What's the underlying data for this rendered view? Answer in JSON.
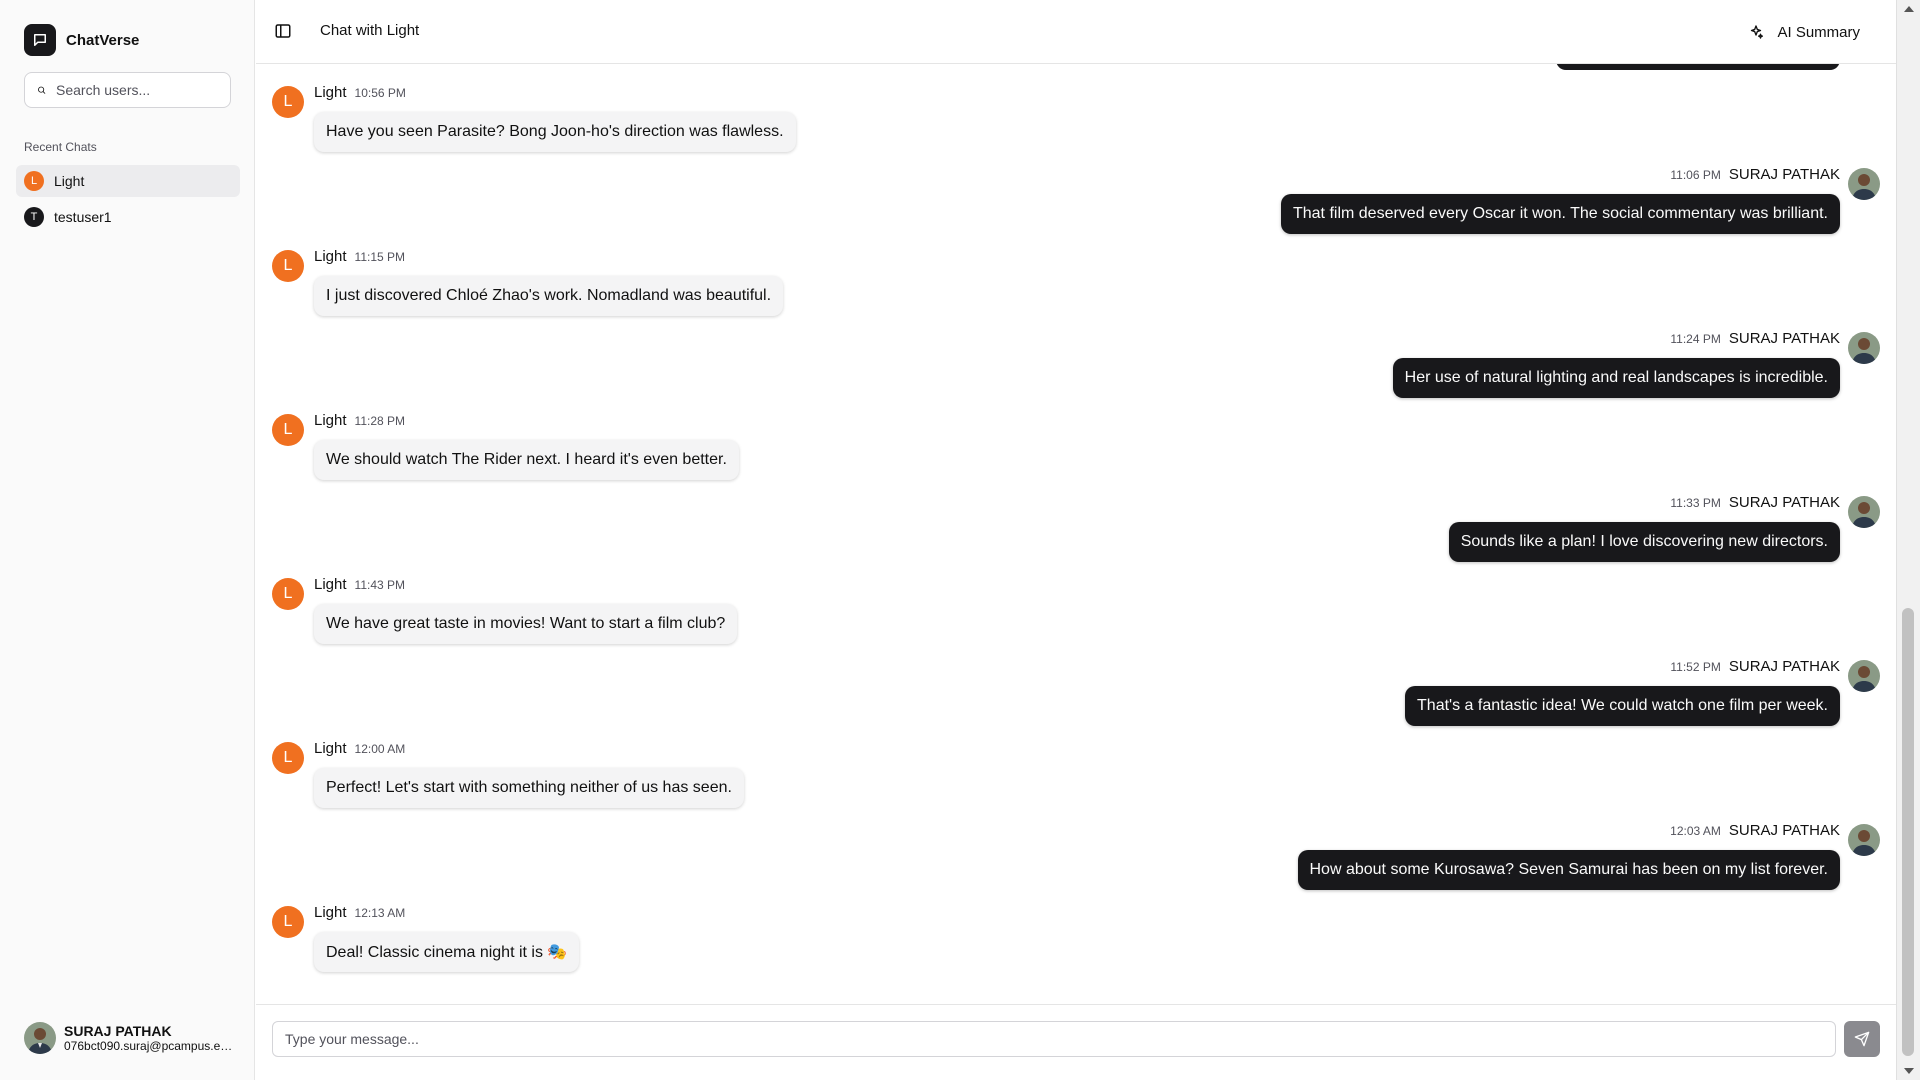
{
  "app": {
    "name": "ChatVerse"
  },
  "sidebar": {
    "search_placeholder": "Search users...",
    "section_label": "Recent Chats",
    "chats": [
      {
        "label": "Light",
        "initial": "L",
        "color": "#f07020",
        "active": true
      },
      {
        "label": "testuser1",
        "initial": "T",
        "color": "#18181b",
        "active": false
      }
    ],
    "profile": {
      "name": "SURAJ PATHAK",
      "email": "076bct090.suraj@pcampus.edu.np"
    }
  },
  "header": {
    "title": "Chat with Light",
    "ai_summary_label": "AI Summary"
  },
  "messages": [
    {
      "from": "Light",
      "initial": "L",
      "time": "10:56 PM",
      "text": "Have you seen Parasite? Bong Joon-ho's direction was flawless.",
      "outgoing": false
    },
    {
      "from": "SURAJ PATHAK",
      "time": "11:06 PM",
      "text": "That film deserved every Oscar it won. The social commentary was brilliant.",
      "outgoing": true
    },
    {
      "from": "Light",
      "initial": "L",
      "time": "11:15 PM",
      "text": "I just discovered Chloé Zhao's work. Nomadland was beautiful.",
      "outgoing": false
    },
    {
      "from": "SURAJ PATHAK",
      "time": "11:24 PM",
      "text": "Her use of natural lighting and real landscapes is incredible.",
      "outgoing": true
    },
    {
      "from": "Light",
      "initial": "L",
      "time": "11:28 PM",
      "text": "We should watch The Rider next. I heard it's even better.",
      "outgoing": false
    },
    {
      "from": "SURAJ PATHAK",
      "time": "11:33 PM",
      "text": "Sounds like a plan! I love discovering new directors.",
      "outgoing": true
    },
    {
      "from": "Light",
      "initial": "L",
      "time": "11:43 PM",
      "text": "We have great taste in movies! Want to start a film club?",
      "outgoing": false
    },
    {
      "from": "SURAJ PATHAK",
      "time": "11:52 PM",
      "text": "That's a fantastic idea! We could watch one film per week.",
      "outgoing": true
    },
    {
      "from": "Light",
      "initial": "L",
      "time": "12:00 AM",
      "text": "Perfect! Let's start with something neither of us has seen.",
      "outgoing": false
    },
    {
      "from": "SURAJ PATHAK",
      "time": "12:03 AM",
      "text": "How about some Kurosawa? Seven Samurai has been on my list forever.",
      "outgoing": true
    },
    {
      "from": "Light",
      "initial": "L",
      "time": "12:13 AM",
      "text": "Deal! Classic cinema night it is 🎭",
      "outgoing": false
    }
  ],
  "composer": {
    "placeholder": "Type your message..."
  },
  "colors": {
    "light_avatar": "#f07020",
    "outgoing_bubble": "#18181b",
    "incoming_bubble": "#f4f4f5"
  }
}
